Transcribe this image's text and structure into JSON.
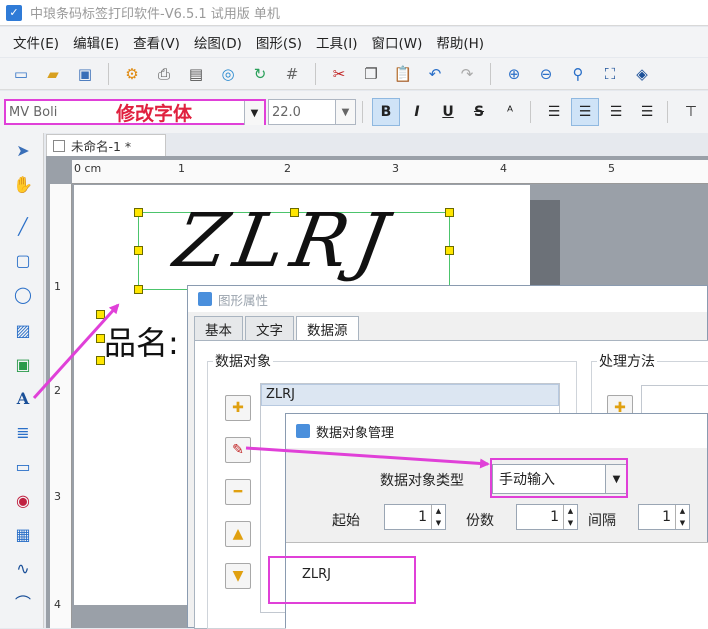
{
  "window": {
    "title": "中琅条码标签打印软件-V6.5.1 试用版 单机"
  },
  "menu": [
    "文件(E)",
    "编辑(E)",
    "查看(V)",
    "绘图(D)",
    "图形(S)",
    "工具(I)",
    "窗口(W)",
    "帮助(H)"
  ],
  "font_toolbar": {
    "font_name": "MV Boli",
    "annotation": "修改字体",
    "font_size": "22.0",
    "bold": "B",
    "italic": "I",
    "underline": "U",
    "strike": "S"
  },
  "document": {
    "tab_title": "未命名-1 *"
  },
  "rulers": {
    "h": [
      "0 cm",
      "1",
      "2",
      "3",
      "4",
      "5"
    ],
    "v": [
      "1",
      "2",
      "3",
      "4"
    ]
  },
  "canvas": {
    "barcode_text": "ZLRJ",
    "label_text": "品名:"
  },
  "graphic_properties": {
    "title": "图形属性",
    "tabs": [
      "基本",
      "文字",
      "数据源"
    ],
    "active_tab": "数据源",
    "data_objects_label": "数据对象",
    "processing_label": "处理方法",
    "data_objects": [
      "ZLRJ"
    ]
  },
  "data_object_manager": {
    "title": "数据对象管理",
    "type_label": "数据对象类型",
    "type_value": "手动输入",
    "start_label": "起始",
    "start_value": "1",
    "copies_label": "份数",
    "copies_value": "1",
    "interval_label": "间隔",
    "interval_value": "1",
    "input_value": "ZLRJ"
  },
  "colors": {
    "highlight": "#e040d8",
    "annotation": "#e0213f",
    "selection": "#4cc46c",
    "handle": "#ffe600"
  }
}
